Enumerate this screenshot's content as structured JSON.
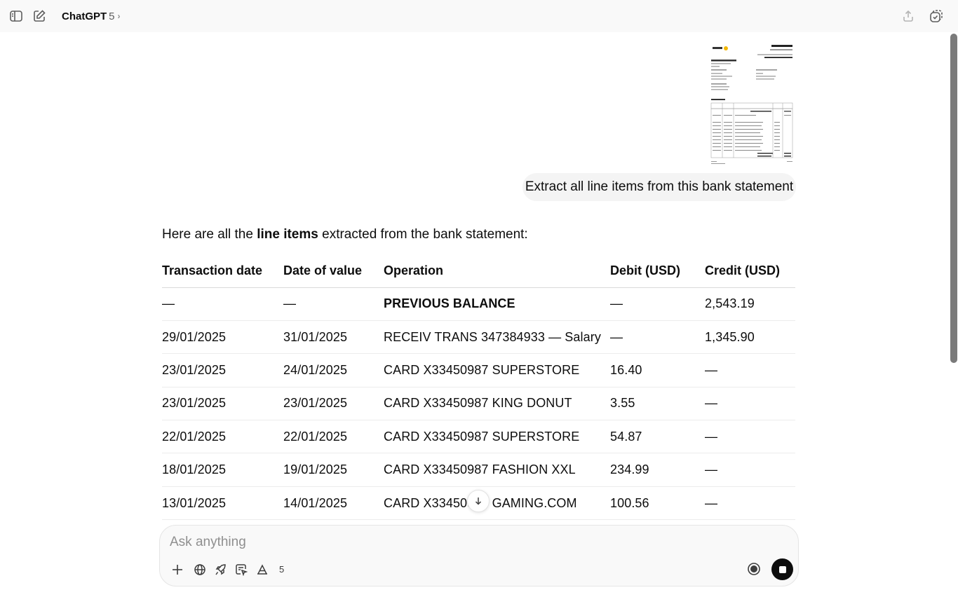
{
  "header": {
    "app_name": "ChatGPT",
    "version": "5",
    "icons": [
      "sidebar-toggle-icon",
      "new-chat-icon",
      "share-icon",
      "temporary-chat-icon"
    ]
  },
  "user_message": {
    "attachment_icon": "bank-statement-thumbnail",
    "text": "Extract all line items from this bank statement"
  },
  "assistant": {
    "intro_pre": "Here are all the ",
    "intro_bold": "line items",
    "intro_post": " extracted from the bank statement:",
    "table": {
      "headers": [
        "Transaction date",
        "Date of value",
        "Operation",
        "Debit (USD)",
        "Credit (USD)"
      ],
      "rows": [
        [
          "—",
          "—",
          "PREVIOUS BALANCE",
          "—",
          "2,543.19"
        ],
        [
          "29/01/2025",
          "31/01/2025",
          "RECEIV TRANS 347384933 — Salary",
          "—",
          "1,345.90"
        ],
        [
          "23/01/2025",
          "24/01/2025",
          "CARD X33450987 SUPERSTORE",
          "16.40",
          "—"
        ],
        [
          "23/01/2025",
          "23/01/2025",
          "CARD X33450987 KING DONUT",
          "3.55",
          "—"
        ],
        [
          "22/01/2025",
          "22/01/2025",
          "CARD X33450987 SUPERSTORE",
          "54.87",
          "—"
        ],
        [
          "18/01/2025",
          "19/01/2025",
          "CARD X33450987 FASHION XXL",
          "234.99",
          "—"
        ],
        [
          "13/01/2025",
          "14/01/2025",
          "CARD X33450987 GAMING.COM",
          "100.56",
          "—"
        ]
      ]
    }
  },
  "composer": {
    "placeholder": "Ask anything",
    "tool_count": "5",
    "tool_icons": [
      "plus-icon",
      "globe-icon",
      "rocket-icon",
      "canvas-icon",
      "font-icon"
    ]
  }
}
